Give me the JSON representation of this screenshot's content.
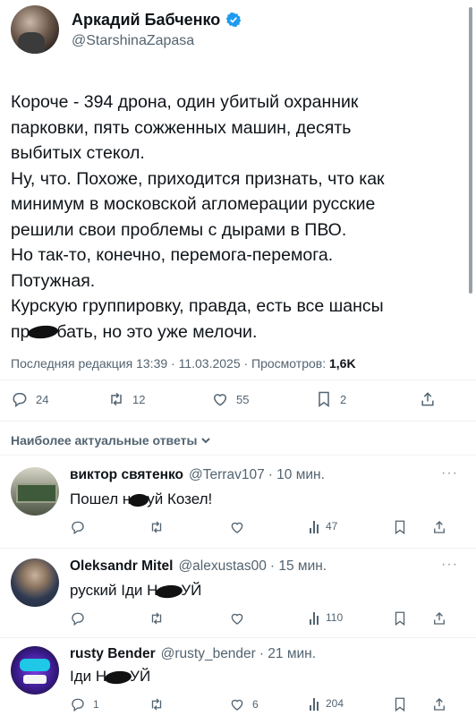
{
  "tweet": {
    "author": {
      "display_name": "Аркадий Бабченко",
      "handle": "@StarshinaZapasa",
      "verified": true
    },
    "text_lines": [
      "Короче - 394 дрона, один убитый охранник",
      "парковки, пять сожженных машин, десять",
      "выбитых стекол.",
      "Ну, что. Похоже, приходится признать, что как",
      "минимум в московской агломерации русские",
      "решили свои проблемы с дырами в ПВО.",
      "Но так-то, конечно, перемога-перемога.",
      "Потужная.",
      "Курскую группировку, правда, есть все шансы"
    ],
    "last_line_prefix": "пр",
    "last_line_suffix": "бать, но это уже мелочи.",
    "meta_text": "Последняя редакция 13:39 · 11.03.2025 · Просмотров: ",
    "views": "1,6K",
    "actions": {
      "replies": "24",
      "reposts": "12",
      "likes": "55",
      "bookmarks": "2"
    }
  },
  "replies_header": "Наиболее актуальные ответы",
  "replies": [
    {
      "name": "виктор святенко",
      "handle": "@Terrav107",
      "time": "· 10 мин.",
      "text_prefix": "Пошел н",
      "text_suffix": "уй Козел!",
      "stats": {
        "replies": "",
        "reposts": "",
        "likes": "",
        "views": "47"
      }
    },
    {
      "name": "Oleksandr Mitel",
      "handle": "@alexustas00",
      "time": "· 15 мин.",
      "text_prefix": "руский Іди Н",
      "text_suffix": "УЙ",
      "stats": {
        "replies": "",
        "reposts": "",
        "likes": "",
        "views": "110"
      }
    },
    {
      "name": "rusty Bender",
      "handle": "@rusty_bender",
      "time": "· 21 мин.",
      "text_prefix": "Іди Н",
      "text_suffix": "УЙ",
      "stats": {
        "replies": "1",
        "reposts": "",
        "likes": "6",
        "views": "204"
      }
    }
  ],
  "more_label": "···",
  "icons": {
    "verified": "verified-badge-icon",
    "reply": "reply-icon",
    "repost": "repost-icon",
    "like": "heart-icon",
    "bookmark": "bookmark-icon",
    "share": "share-icon",
    "views": "views-icon"
  },
  "colors": {
    "verified": "#1d9bf0",
    "muted": "#536471",
    "text": "#0f1419"
  }
}
